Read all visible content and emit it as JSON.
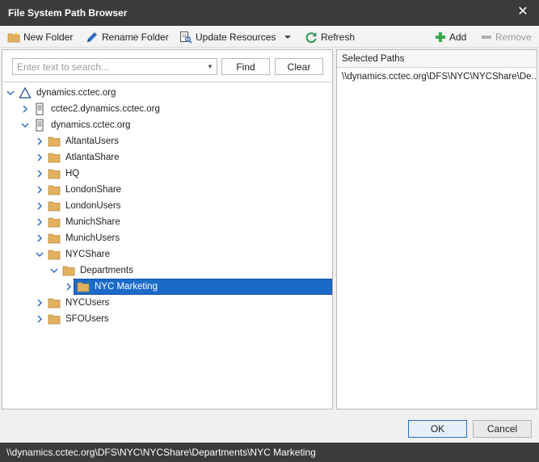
{
  "window": {
    "title": "File System Path Browser"
  },
  "toolbar": {
    "new_folder": "New Folder",
    "rename_folder": "Rename Folder",
    "update_resources": "Update Resources",
    "refresh": "Refresh",
    "add": "Add",
    "remove": "Remove"
  },
  "search": {
    "placeholder": "Enter text to search...",
    "value": "",
    "find_label": "Find",
    "clear_label": "Clear"
  },
  "tree": {
    "root": {
      "label": "dynamics.cctec.org",
      "icon": "domain-triangle-icon",
      "expanded": true
    },
    "server_1": {
      "label": "cctec2.dynamics.cctec.org",
      "icon": "server-icon",
      "expanded": false
    },
    "server_2": {
      "label": "dynamics.cctec.org",
      "icon": "server-icon",
      "expanded": true
    },
    "folders": [
      {
        "label": "AltantaUsers"
      },
      {
        "label": "AtlantaShare"
      },
      {
        "label": "HQ"
      },
      {
        "label": "LondonShare"
      },
      {
        "label": "LondonUsers"
      },
      {
        "label": "MunichShare"
      },
      {
        "label": "MunichUsers"
      },
      {
        "label": "NYCShare"
      }
    ],
    "departments": {
      "label": "Departments"
    },
    "selected": {
      "label": "NYC Marketing"
    },
    "folders_after": [
      {
        "label": "NYCUsers"
      },
      {
        "label": "SFOUsers"
      }
    ]
  },
  "selected_paths": {
    "header": "Selected Paths",
    "items": [
      "\\\\dynamics.cctec.org\\DFS\\NYC\\NYCShare\\De..."
    ]
  },
  "footer": {
    "ok_label": "OK",
    "cancel_label": "Cancel"
  },
  "status": {
    "path": "\\\\dynamics.cctec.org\\DFS\\NYC\\NYCShare\\Departments\\NYC Marketing"
  },
  "colors": {
    "titlebar": "#3b3b3b",
    "selection": "#1b6ac9",
    "folder": "#e2b15f",
    "chevron": "#2f6fc3",
    "add_green": "#3aa84a",
    "refresh_green": "#2f9a58"
  }
}
